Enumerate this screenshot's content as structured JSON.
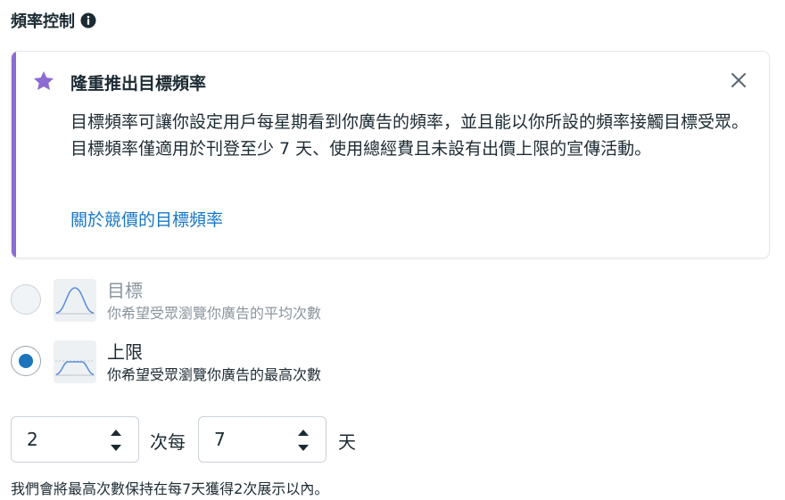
{
  "header": {
    "title": "頻率控制",
    "info_icon": "info-icon"
  },
  "banner": {
    "accent_color": "#8c6cd1",
    "icon": "star-icon",
    "title": "隆重推出目標頻率",
    "body": "目標頻率可讓你設定用戶每星期看到你廣告的頻率，並且能以你所設的頻率接觸目標受眾。目標頻率僅適用於刊登至少 7 天、使用總經費且未設有出價上限的宣傳活動。",
    "link_text": "關於競價的目標頻率",
    "close_icon": "close-icon"
  },
  "options": [
    {
      "label": "目標",
      "description": "你希望受眾瀏覽你廣告的平均次數",
      "selected": false
    },
    {
      "label": "上限",
      "description": "你希望受眾瀏覽你廣告的最高次數",
      "selected": true
    }
  ],
  "frequency": {
    "times_value": "2",
    "times_unit": "次每",
    "days_value": "7",
    "days_unit": "天"
  },
  "summary": "我們會將最高次數保持在每7天獲得2次展示以內。",
  "colors": {
    "link": "#1877c5",
    "radio_selected": "#1c75bc"
  }
}
